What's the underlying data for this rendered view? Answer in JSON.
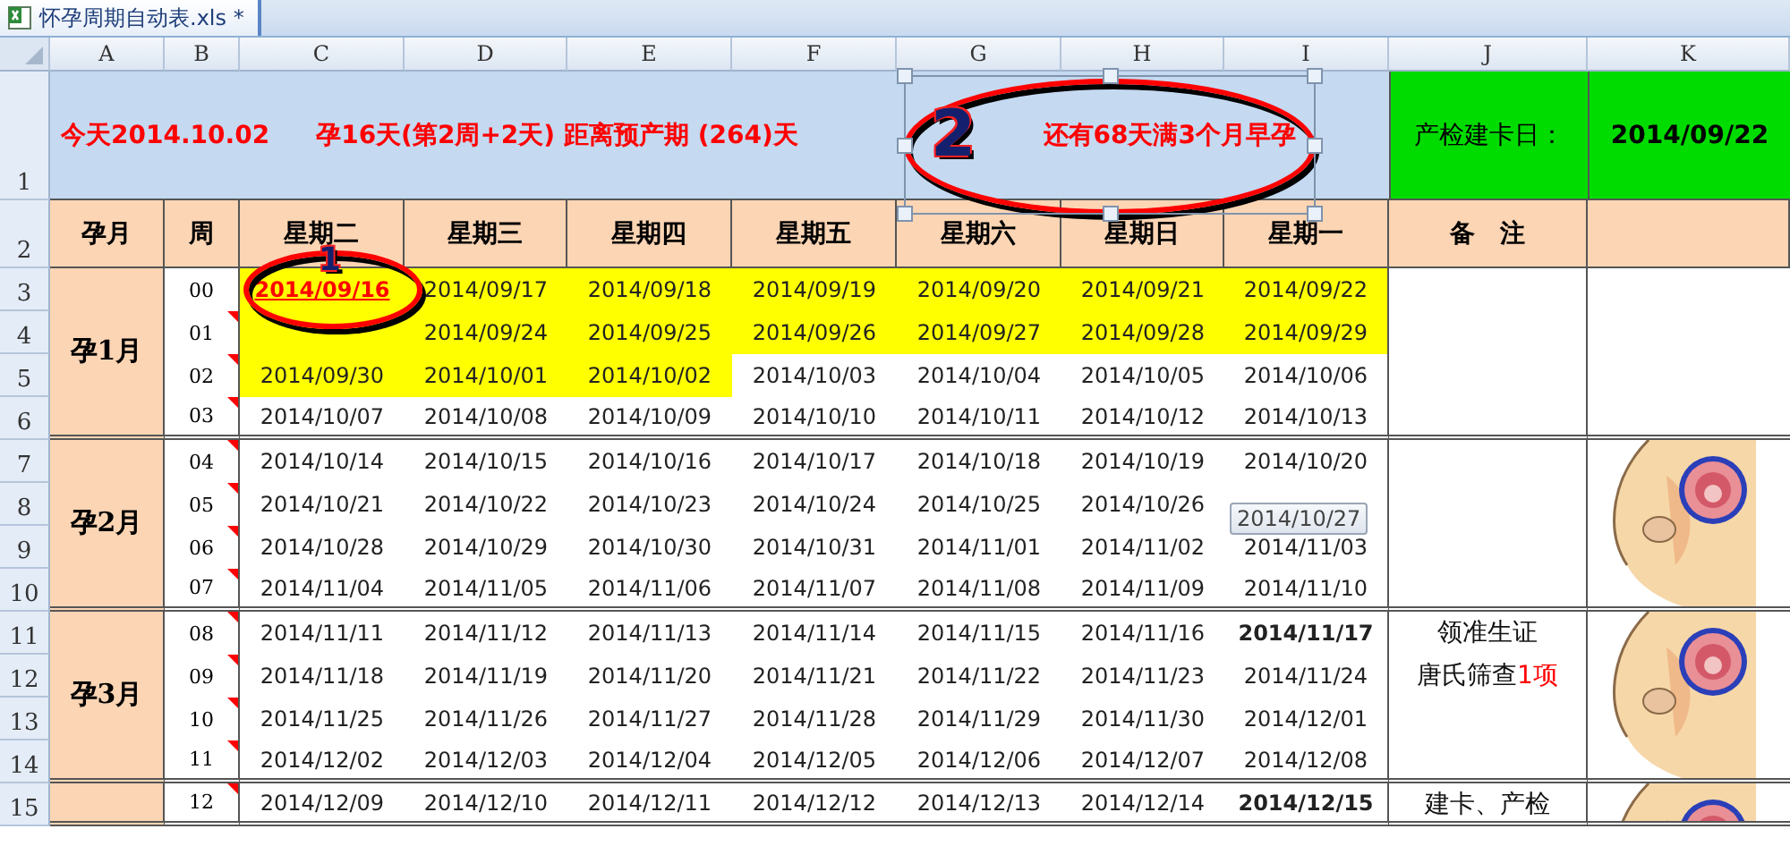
{
  "tab": {
    "title": "怀孕周期自动表.xls *"
  },
  "column_letters": [
    "A",
    "B",
    "C",
    "D",
    "E",
    "F",
    "G",
    "H",
    "I",
    "J",
    "K"
  ],
  "row_numbers": [
    "1",
    "2",
    "3",
    "4",
    "5",
    "6",
    "7",
    "8",
    "9",
    "10",
    "11",
    "12",
    "13",
    "14",
    "15"
  ],
  "summary": {
    "today": "今天2014.10.02",
    "progress": "孕16天(第2周+2天) 距离预产期 (264)天",
    "countdown": "还有68天满3个月早孕",
    "card_label": "产检建卡日：",
    "card_date": "2014/09/22"
  },
  "headers": [
    "孕月",
    "周",
    "星期二",
    "星期三",
    "星期四",
    "星期五",
    "星期六",
    "星期日",
    "星期一",
    "备　注"
  ],
  "groups": [
    {
      "month": "孕1月",
      "picture": false,
      "weeks": [
        {
          "week": "00",
          "comment": false,
          "cells": [
            {
              "date": "2014/09/16",
              "highlighted": true,
              "marked": true
            },
            {
              "date": "2014/09/17",
              "highlighted": true
            },
            {
              "date": "2014/09/18",
              "highlighted": true
            },
            {
              "date": "2014/09/19",
              "highlighted": true
            },
            {
              "date": "2014/09/20",
              "highlighted": true
            },
            {
              "date": "2014/09/21",
              "highlighted": true
            },
            {
              "date": "2014/09/22",
              "highlighted": true
            }
          ]
        },
        {
          "week": "01",
          "comment": true,
          "cells": [
            {
              "highlighted": true
            },
            {
              "date": "2014/09/24",
              "highlighted": true
            },
            {
              "date": "2014/09/25",
              "highlighted": true
            },
            {
              "date": "2014/09/26",
              "highlighted": true
            },
            {
              "date": "2014/09/27",
              "highlighted": true
            },
            {
              "date": "2014/09/28",
              "highlighted": true
            },
            {
              "date": "2014/09/29",
              "highlighted": true
            }
          ]
        },
        {
          "week": "02",
          "comment": true,
          "cells": [
            {
              "date": "2014/09/30",
              "highlighted": true
            },
            {
              "date": "2014/10/01",
              "highlighted": true
            },
            {
              "date": "2014/10/02",
              "highlighted": true
            },
            {
              "date": "2014/10/03",
              "highlighted": false
            },
            {
              "date": "2014/10/04",
              "highlighted": false
            },
            {
              "date": "2014/10/05",
              "highlighted": false
            },
            {
              "date": "2014/10/06",
              "highlighted": false
            }
          ]
        },
        {
          "week": "03",
          "comment": true,
          "cells": [
            {
              "date": "2014/10/07",
              "highlighted": false
            },
            {
              "date": "2014/10/08",
              "highlighted": false
            },
            {
              "date": "2014/10/09",
              "highlighted": false
            },
            {
              "date": "2014/10/10",
              "highlighted": false
            },
            {
              "date": "2014/10/11",
              "highlighted": false
            },
            {
              "date": "2014/10/12",
              "highlighted": false
            },
            {
              "date": "2014/10/13",
              "highlighted": false
            }
          ]
        }
      ]
    },
    {
      "month": "孕2月",
      "picture": true,
      "weeks": [
        {
          "week": "04",
          "comment": true,
          "cells": [
            {
              "date": "2014/10/14",
              "highlighted": false
            },
            {
              "date": "2014/10/15",
              "highlighted": false
            },
            {
              "date": "2014/10/16",
              "highlighted": false
            },
            {
              "date": "2014/10/17",
              "highlighted": false
            },
            {
              "date": "2014/10/18",
              "highlighted": false
            },
            {
              "date": "2014/10/19",
              "highlighted": false
            },
            {
              "date": "2014/10/20",
              "highlighted": false
            }
          ]
        },
        {
          "week": "05",
          "comment": true,
          "cells": [
            {
              "date": "2014/10/21",
              "highlighted": false
            },
            {
              "date": "2014/10/22",
              "highlighted": false
            },
            {
              "date": "2014/10/23",
              "highlighted": false
            },
            {
              "date": "2014/10/24",
              "highlighted": false
            },
            {
              "date": "2014/10/25",
              "highlighted": false
            },
            {
              "date": "2014/10/26",
              "highlighted": false
            },
            {
              "highlighted": false
            }
          ]
        },
        {
          "week": "06",
          "comment": true,
          "cells": [
            {
              "date": "2014/10/28",
              "highlighted": false
            },
            {
              "date": "2014/10/29",
              "highlighted": false
            },
            {
              "date": "2014/10/30",
              "highlighted": false
            },
            {
              "date": "2014/10/31",
              "highlighted": false
            },
            {
              "date": "2014/11/01",
              "highlighted": false
            },
            {
              "date": "2014/11/02",
              "highlighted": false
            },
            {
              "date": "2014/11/03",
              "highlighted": false
            }
          ]
        },
        {
          "week": "07",
          "comment": true,
          "cells": [
            {
              "date": "2014/11/04",
              "highlighted": false
            },
            {
              "date": "2014/11/05",
              "highlighted": false
            },
            {
              "date": "2014/11/06",
              "highlighted": false
            },
            {
              "date": "2014/11/07",
              "highlighted": false
            },
            {
              "date": "2014/11/08",
              "highlighted": false
            },
            {
              "date": "2014/11/09",
              "highlighted": false
            },
            {
              "date": "2014/11/10",
              "highlighted": false
            }
          ]
        }
      ]
    },
    {
      "month": "孕3月",
      "picture": true,
      "notes": [
        {
          "text": "领准生证"
        },
        {
          "text": "唐氏筛查",
          "accent": "1项"
        }
      ],
      "weeks": [
        {
          "week": "08",
          "comment": true,
          "cells": [
            {
              "date": "2014/11/11",
              "highlighted": false
            },
            {
              "date": "2014/11/12",
              "highlighted": false
            },
            {
              "date": "2014/11/13",
              "highlighted": false
            },
            {
              "date": "2014/11/14",
              "highlighted": false
            },
            {
              "date": "2014/11/15",
              "highlighted": false
            },
            {
              "date": "2014/11/16",
              "highlighted": false
            },
            {
              "date": "2014/11/17",
              "highlighted": false,
              "bold": true
            }
          ]
        },
        {
          "week": "09",
          "comment": true,
          "cells": [
            {
              "date": "2014/11/18",
              "highlighted": false
            },
            {
              "date": "2014/11/19",
              "highlighted": false
            },
            {
              "date": "2014/11/20",
              "highlighted": false
            },
            {
              "date": "2014/11/21",
              "highlighted": false
            },
            {
              "date": "2014/11/22",
              "highlighted": false
            },
            {
              "date": "2014/11/23",
              "highlighted": false
            },
            {
              "date": "2014/11/24",
              "highlighted": false
            }
          ]
        },
        {
          "week": "10",
          "comment": true,
          "cells": [
            {
              "date": "2014/11/25",
              "highlighted": false
            },
            {
              "date": "2014/11/26",
              "highlighted": false
            },
            {
              "date": "2014/11/27",
              "highlighted": false
            },
            {
              "date": "2014/11/28",
              "highlighted": false
            },
            {
              "date": "2014/11/29",
              "highlighted": false
            },
            {
              "date": "2014/11/30",
              "highlighted": false
            },
            {
              "date": "2014/12/01",
              "highlighted": false
            }
          ]
        },
        {
          "week": "11",
          "comment": true,
          "cells": [
            {
              "date": "2014/12/02",
              "highlighted": false
            },
            {
              "date": "2014/12/03",
              "highlighted": false
            },
            {
              "date": "2014/12/04",
              "highlighted": false
            },
            {
              "date": "2014/12/05",
              "highlighted": false
            },
            {
              "date": "2014/12/06",
              "highlighted": false
            },
            {
              "date": "2014/12/07",
              "highlighted": false
            },
            {
              "date": "2014/12/08",
              "highlighted": false
            }
          ]
        }
      ]
    },
    {
      "picture": true,
      "notes": [
        {
          "text": "建卡、产检"
        }
      ],
      "weeks": [
        {
          "week": "12",
          "comment": true,
          "cells": [
            {
              "date": "2014/12/09",
              "highlighted": false
            },
            {
              "date": "2014/12/10",
              "highlighted": false
            },
            {
              "date": "2014/12/11",
              "highlighted": false
            },
            {
              "date": "2014/12/12",
              "highlighted": false
            },
            {
              "date": "2014/12/13",
              "highlighted": false
            },
            {
              "date": "2014/12/14",
              "highlighted": false
            },
            {
              "date": "2014/12/15",
              "highlighted": false,
              "bold": true
            }
          ]
        }
      ]
    }
  ],
  "tooltip": "2014/10/27",
  "annotations": [
    {
      "label": "1",
      "selected": false
    },
    {
      "label": "2",
      "selected": true
    }
  ]
}
